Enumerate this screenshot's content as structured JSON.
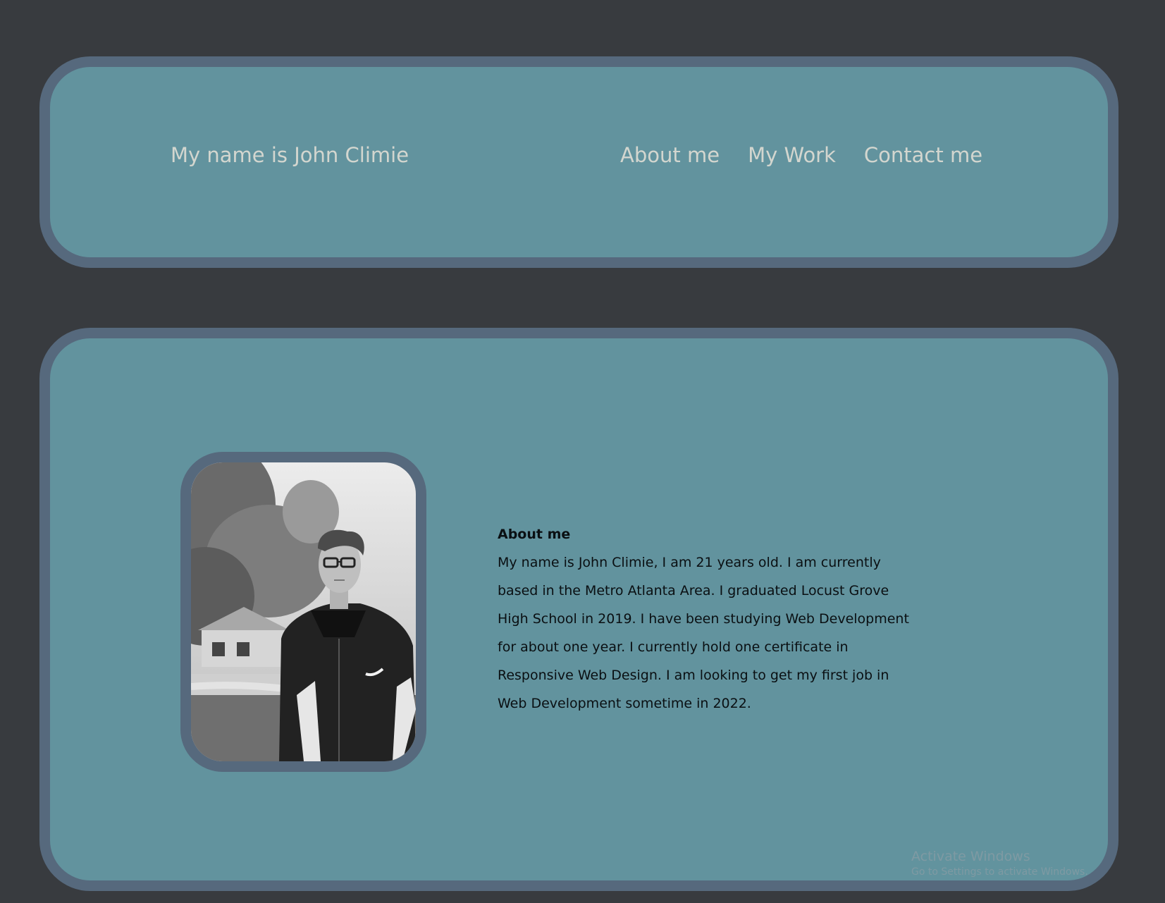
{
  "header": {
    "title": "My name is John Climie",
    "nav": [
      {
        "label": "About me"
      },
      {
        "label": "My Work"
      },
      {
        "label": "Contact me"
      }
    ]
  },
  "about": {
    "heading": "About me",
    "text": "My name is John Climie, I am 21 years old. I am currently based in the Metro Atlanta Area. I graduated Locust Grove High School in 2019. I have been studying Web Development for about one year. I currently hold one certificate in Responsive Web Design. I am looking to get my first job in Web Development sometime in 2022."
  },
  "watermark": {
    "title": "Activate Windows",
    "subtitle": "Go to Settings to activate Windows."
  },
  "colors": {
    "page_background": "#383b3f",
    "card_background": "#62939e",
    "card_border": "#56697d",
    "header_text": "#d3d6cf",
    "body_text": "#0a0f12"
  }
}
